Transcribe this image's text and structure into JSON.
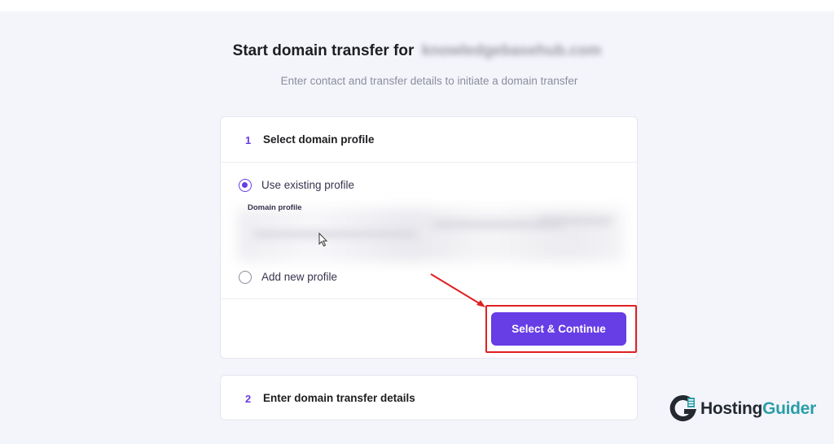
{
  "header": {
    "title_prefix": "Start domain transfer for",
    "domain_blurred": "knowledgebasehub.com",
    "subtitle": "Enter contact and transfer details to initiate a domain transfer"
  },
  "step1": {
    "number": "1",
    "title": "Select domain profile",
    "option_existing": "Use existing profile",
    "field_label": "Domain profile",
    "option_new": "Add new profile",
    "selected_option": "existing",
    "continue_label": "Select & Continue"
  },
  "step2": {
    "number": "2",
    "title": "Enter domain transfer details"
  },
  "watermark": {
    "brand_dark": "Hosting",
    "brand_accent": "Guider",
    "icon": "g-logo-icon"
  },
  "colors": {
    "accent": "#673de6",
    "annotation": "#e02020",
    "watermark_accent": "#2b9ea8"
  }
}
